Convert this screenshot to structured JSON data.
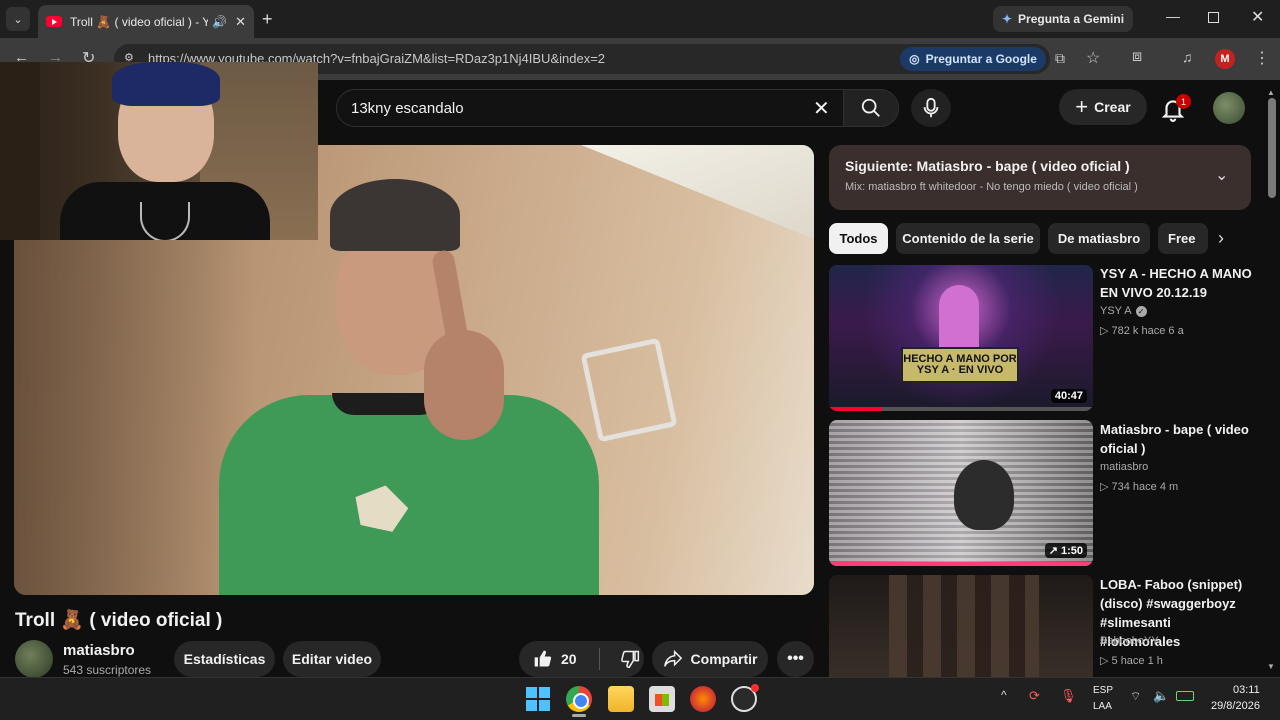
{
  "browser": {
    "tab_title": "Troll 🧸 ( video oficial ) - Yo",
    "gemini_label": "Pregunta a Gemini",
    "url": "https://www.youtube.com/watch?v=fnbajGraiZM&list=RDaz3p1Nj4IBU&index=2",
    "google_btn_label": "Preguntar a Google",
    "profile_initial": "M"
  },
  "masthead": {
    "search_value": "13kny escandalo",
    "create_label": "Crear",
    "notification_count": "1"
  },
  "video": {
    "title": "Troll 🧸 ( video oficial )",
    "channel_name": "matiasbro",
    "subscribers": "543 suscriptores",
    "stats_label": "Estadísticas",
    "edit_label": "Editar video",
    "like_count": "20",
    "share_label": "Compartir"
  },
  "playlist": {
    "next_title": "Siguiente: Matiasbro - bape ( video oficial )",
    "mix_subtitle": "Mix: matiasbro ft whitedoor - No tengo miedo ( video oficial )"
  },
  "chips": [
    "Todos",
    "Contenido de la serie",
    "De matiasbro",
    "Free"
  ],
  "related": [
    {
      "title": "YSY A - HECHO A MANO EN VIVO 20.12.19",
      "channel": "YSY A",
      "meta": "▷ 782 k   hace 6 a",
      "duration": "40:47",
      "thumb_text": "HECHO A MANO POR YSY A · EN VIVO",
      "progress": 0.2
    },
    {
      "title": "Matiasbro - bape ( video oficial )",
      "channel": "matiasbro",
      "meta": "▷ 734   hace 4 m",
      "duration": "↗ 1:50"
    },
    {
      "title": "LOBA- Faboo (snippet) (disco) #swaggerboyz #slimesanti #lolomorales",
      "channel": "BabooboYY",
      "meta": "▷ 5   hace 1 h"
    }
  ],
  "taskbar": {
    "lang_top": "ESP",
    "lang_bottom": "LAA",
    "time": "03:11",
    "date": "29/8/2026"
  }
}
